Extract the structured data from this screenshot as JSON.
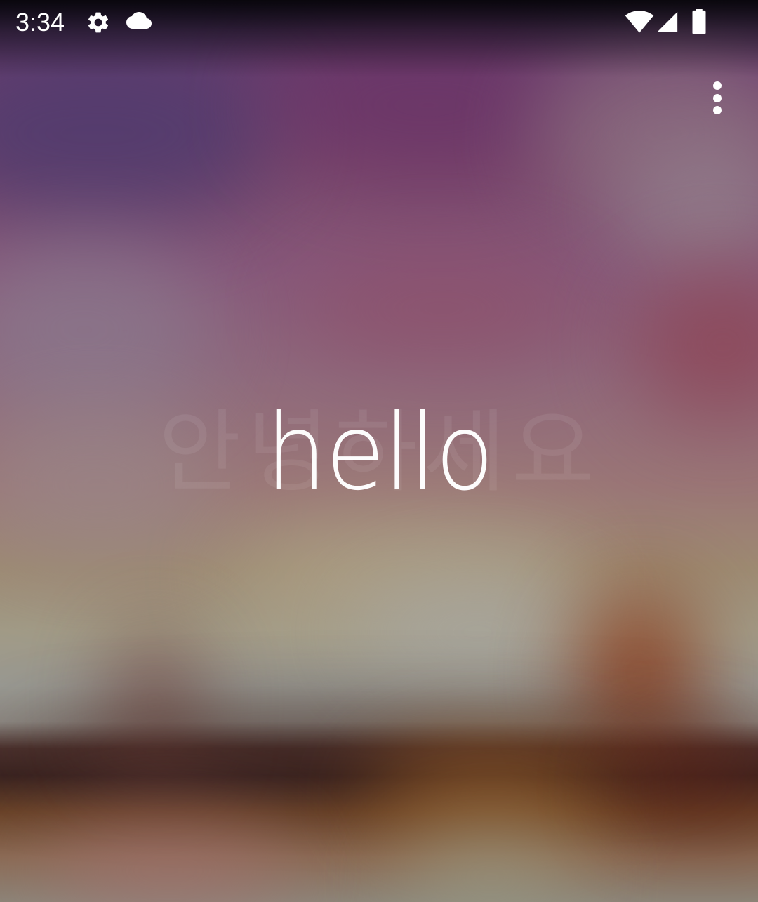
{
  "status_bar": {
    "time": "3:34",
    "icons": [
      "settings-gear-icon",
      "cloud-icon",
      "wifi-icon",
      "cell-signal-icon",
      "battery-icon"
    ]
  },
  "toolbar": {
    "overflow_icon": "more-vert-icon"
  },
  "main": {
    "greeting": "hello",
    "ghost_greeting": "안녕하세요"
  },
  "colors": {
    "text": "#ffffff",
    "wallpaper_top": "#5a3a6a",
    "wallpaper_mid": "#8f6a7c",
    "wallpaper_bottom": "#8a6a54"
  }
}
